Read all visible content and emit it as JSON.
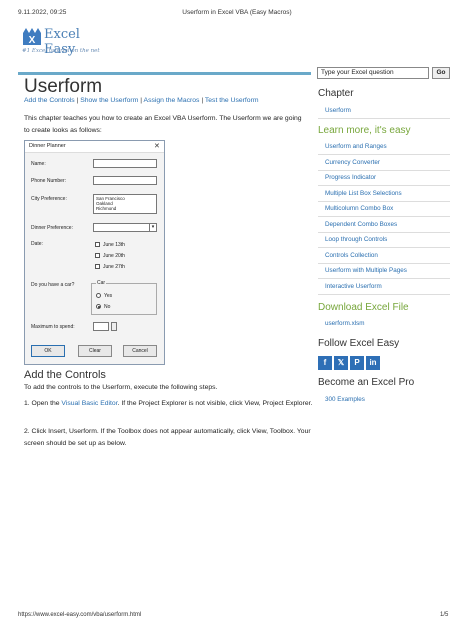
{
  "print_header": {
    "datetime": "9.11.2022, 09:25",
    "title": "Userform in Excel VBA (Easy Macros)"
  },
  "logo": {
    "name": "Excel Easy",
    "tagline": "#1 Excel tutorial on the net"
  },
  "search": {
    "value": "Type your Excel question",
    "button": "Go"
  },
  "page": {
    "title": "Userform",
    "crumbs": [
      "Add the Controls",
      "Show the Userform",
      "Assign the Macros",
      "Test the Userform"
    ],
    "crumb_sep": "|",
    "intro": "This chapter teaches you how to create an Excel VBA Userform. The Userform we are going to create looks as follows:"
  },
  "dialog": {
    "title": "Dinner Planner",
    "close": "✕",
    "labels": {
      "name": "Name:",
      "phone": "Phone Number:",
      "city": "City Preference:",
      "dinner": "Dinner Preference:",
      "date": "Date:",
      "car": "Do you have a car?",
      "money": "Maximum to spend:"
    },
    "cities": [
      "San Francisco",
      "Oakland",
      "Richmond"
    ],
    "dates": [
      "June 13th",
      "June 20th",
      "June 27th"
    ],
    "car_frame": "Car",
    "car_options": [
      "Yes",
      "No"
    ],
    "buttons": {
      "ok": "OK",
      "clear": "Clear",
      "cancel": "Cancel"
    }
  },
  "section": {
    "heading": "Add the Controls",
    "p1": "To add the controls to the Userform, execute the following steps.",
    "p2_a": "1. Open the ",
    "p2_link": "Visual Basic Editor",
    "p2_b": ". If the Project Explorer is not visible, click View, Project Explorer.",
    "p3": "2. Click Insert, Userform. If the Toolbox does not appear automatically, click View, Toolbox. Your screen should be set up as below."
  },
  "sidebar": {
    "chapter_heading": "Chapter",
    "chapter_link": "Userform",
    "learn_heading": "Learn more, it's easy",
    "learn_links": [
      "Userform and Ranges",
      "Currency Converter",
      "Progress Indicator",
      "Multiple List Box Selections",
      "Multicolumn Combo Box",
      "Dependent Combo Boxes",
      "Loop through Controls",
      "Controls Collection",
      "Userform with Multiple Pages",
      "Interactive Userform"
    ],
    "download_heading": "Download Excel File",
    "download_link": "userform.xlsm",
    "follow_heading": "Follow Excel Easy",
    "social": [
      "f",
      "𝕏",
      "P",
      "in"
    ],
    "pro_heading": "Become an Excel Pro",
    "pro_link": "300 Examples"
  },
  "footer": {
    "url": "https://www.excel-easy.com/vba/userform.html",
    "page": "1/5"
  }
}
